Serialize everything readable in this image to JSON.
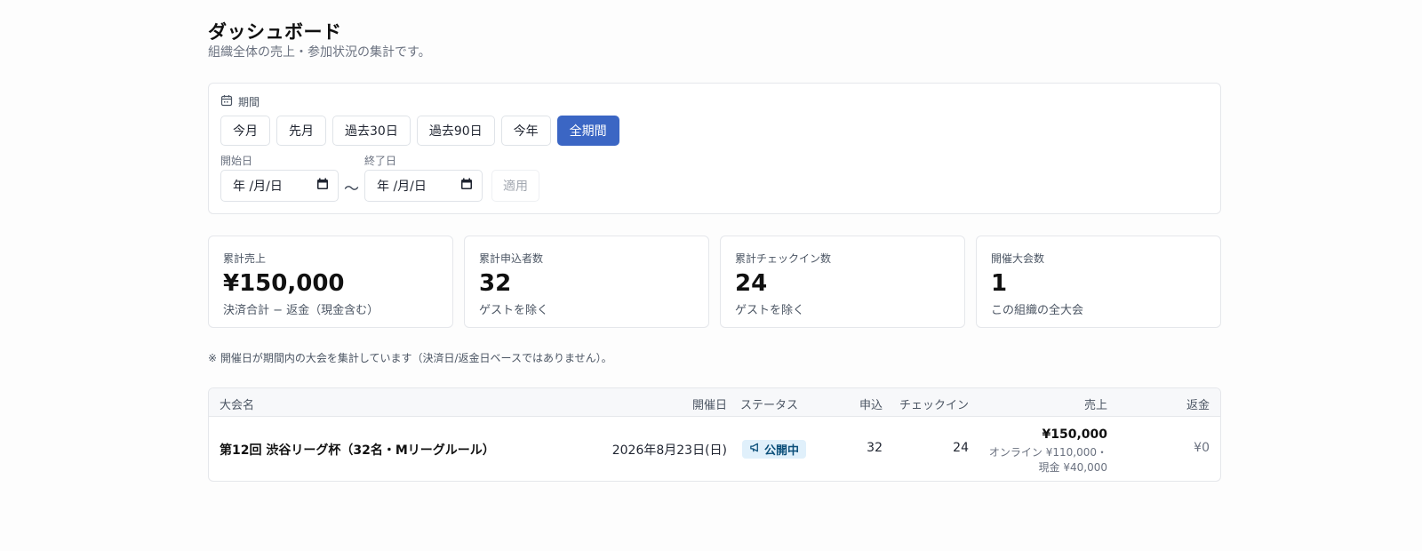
{
  "header": {
    "title": "ダッシュボード",
    "subtitle": "組織全体の売上・参加状況の集計です。"
  },
  "period": {
    "heading": "期間",
    "icon": "calendar-icon",
    "presets": [
      {
        "label": "今月",
        "active": false
      },
      {
        "label": "先月",
        "active": false
      },
      {
        "label": "過去30日",
        "active": false
      },
      {
        "label": "過去90日",
        "active": false
      },
      {
        "label": "今年",
        "active": false
      },
      {
        "label": "全期間",
        "active": true
      }
    ],
    "start_label": "開始日",
    "start_value": "年 /月/日",
    "end_label": "終了日",
    "end_value": "年 /月/日",
    "separator": "〜",
    "apply_label": "適用"
  },
  "stats": [
    {
      "label": "累計売上",
      "value": "¥150,000",
      "note": "決済合計 − 返金（現金含む）"
    },
    {
      "label": "累計申込者数",
      "value": "32",
      "note": "ゲストを除く"
    },
    {
      "label": "累計チェックイン数",
      "value": "24",
      "note": "ゲストを除く"
    },
    {
      "label": "開催大会数",
      "value": "1",
      "note": "この組織の全大会"
    }
  ],
  "footnote": "※ 開催日が期間内の大会を集計しています（決済日/返金日ベースではありません）。",
  "table": {
    "headers": {
      "name": "大会名",
      "date": "開催日",
      "status": "ステータス",
      "applications": "申込",
      "checkins": "チェックイン",
      "sales": "売上",
      "refund": "返金"
    },
    "rows": [
      {
        "name": "第12回 渋谷リーグ杯（32名・Mリーグルール）",
        "date": "2026年8月23日(日)",
        "status": "公開中",
        "status_icon": "megaphone-icon",
        "applications": "32",
        "checkins": "24",
        "sales": "¥150,000",
        "sales_breakdown_1": "オンライン ¥110,000・",
        "sales_breakdown_2": "現金 ¥40,000",
        "refund": "¥0"
      }
    ]
  },
  "colors": {
    "accent": "#3b66c4",
    "badge_bg": "#e0f0fb",
    "badge_text": "#0b4f7a"
  }
}
